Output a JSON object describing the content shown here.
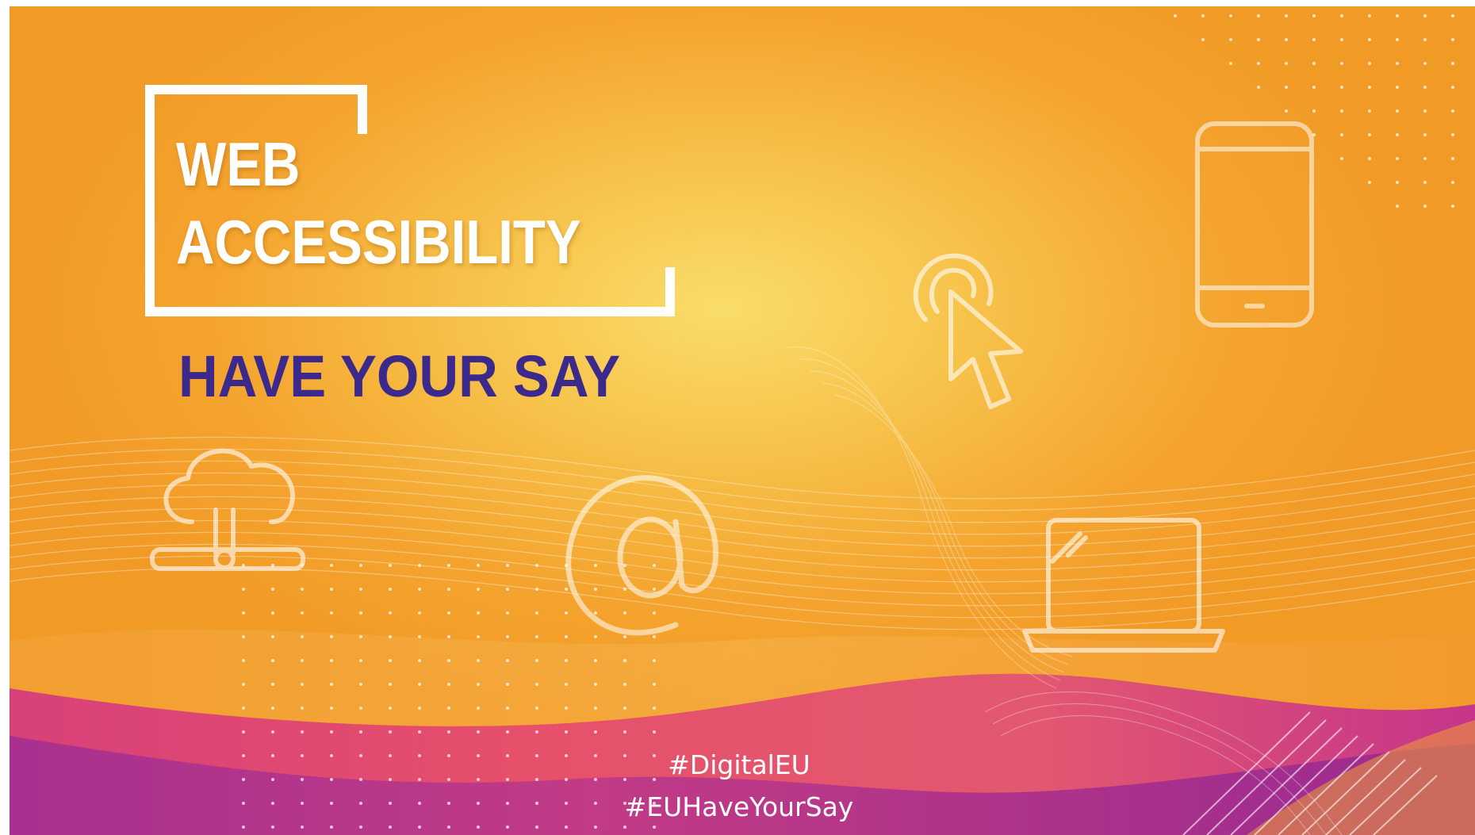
{
  "banner": {
    "title_line1": "WEB",
    "title_line2": "ACCESSIBILITY",
    "subtitle": "HAVE YOUR SAY",
    "hashtags": [
      "#DigitalEU",
      "#EUHaveYourSay"
    ]
  },
  "icons": [
    "cloud-server-icon",
    "at-sign-icon",
    "pointer-click-icon",
    "smartphone-icon",
    "laptop-icon"
  ],
  "colors": {
    "orange": "#f29a26",
    "yellow_glow": "#f9dd6a",
    "pink": "#e0456b",
    "purple": "#b02a8a",
    "title_text": "#ffffff",
    "subtitle_text": "#3b2a8c"
  }
}
